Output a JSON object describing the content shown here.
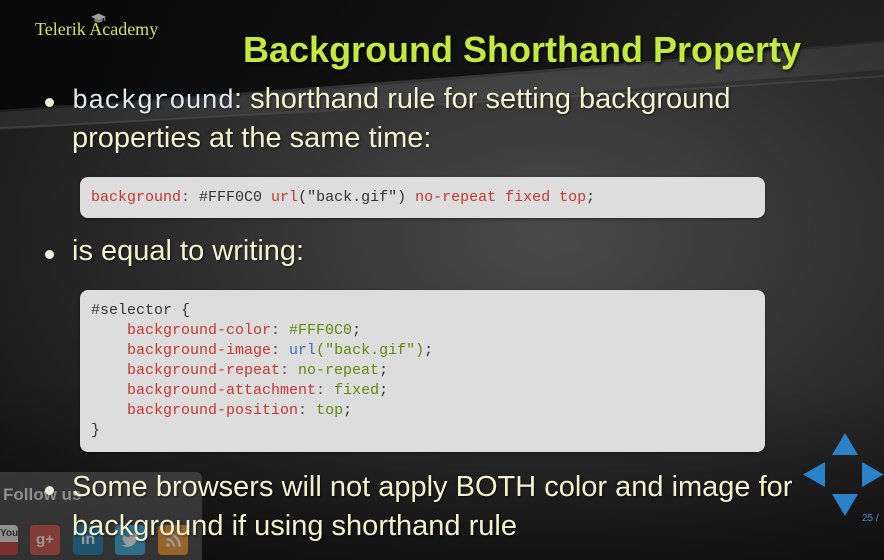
{
  "app": {
    "brand": "Telerik Academy",
    "brand_icon": "graduation-cap-icon"
  },
  "slide": {
    "title": "Background Shorthand Property",
    "bullet_1": {
      "code_term": "background",
      "line_1": ": shorthand rule for setting background",
      "line_2": "properties at the same time:"
    },
    "bullet_2": {
      "line_1": "is equal to writing:"
    },
    "bullet_3": {
      "line_1": "Some browsers will not apply BOTH color and image for",
      "line_2": "background if using shorthand rule"
    },
    "code_blocks": [
      {
        "lines": [
          [
            {
              "t": "background",
              "color": "#c7372f"
            },
            {
              "t": ": ",
              "color": "#555555"
            },
            {
              "t": "#FFF0C0",
              "color": "#333333"
            },
            {
              "t": " url",
              "color": "#c7372f"
            },
            {
              "t": "(\"back.gif\")",
              "color": "#333333"
            },
            {
              "t": " no-repeat fixed top",
              "color": "#c7372f"
            },
            {
              "t": ";",
              "color": "#333333"
            }
          ]
        ]
      },
      {
        "lines": [
          [
            {
              "t": "#selector {",
              "color": "#333333"
            }
          ],
          [
            {
              "t": "    background-color",
              "color": "#c7372f"
            },
            {
              "t": ": ",
              "color": "#555555"
            },
            {
              "t": "#FFF0C0",
              "color": "#5e8a10"
            },
            {
              "t": ";",
              "color": "#333333"
            }
          ],
          [
            {
              "t": "    background-image",
              "color": "#c7372f"
            },
            {
              "t": ": ",
              "color": "#555555"
            },
            {
              "t": "url",
              "color": "#3a6fb6"
            },
            {
              "t": "(\"back.gif\")",
              "color": "#5e8a10"
            },
            {
              "t": ";",
              "color": "#333333"
            }
          ],
          [
            {
              "t": "    background-repeat",
              "color": "#c7372f"
            },
            {
              "t": ": ",
              "color": "#555555"
            },
            {
              "t": "no-repeat",
              "color": "#5e8a10"
            },
            {
              "t": ";",
              "color": "#333333"
            }
          ],
          [
            {
              "t": "    background-attachment",
              "color": "#c7372f"
            },
            {
              "t": ": ",
              "color": "#555555"
            },
            {
              "t": "fixed",
              "color": "#5e8a10"
            },
            {
              "t": ";",
              "color": "#333333"
            }
          ],
          [
            {
              "t": "    background-position",
              "color": "#c7372f"
            },
            {
              "t": ": ",
              "color": "#555555"
            },
            {
              "t": "top",
              "color": "#5e8a10"
            },
            {
              "t": ";",
              "color": "#333333"
            }
          ],
          [
            {
              "t": "}",
              "color": "#333333"
            }
          ]
        ]
      }
    ]
  },
  "follow_widget": {
    "label": "Follow us",
    "icons": [
      {
        "name": "youtube-icon",
        "glyph": "You",
        "color": "#c4302b"
      },
      {
        "name": "google-plus-icon",
        "glyph": "g+",
        "color": "#d34836"
      },
      {
        "name": "linkedin-icon",
        "glyph": "in",
        "color": "#0e76a8"
      },
      {
        "name": "twitter-icon",
        "color": "#2aa9e0"
      },
      {
        "name": "rss-icon",
        "color": "#f7931e"
      }
    ]
  },
  "navigation": {
    "arrows": [
      "nav-up-arrow-icon",
      "nav-left-arrow-icon",
      "nav-right-arrow-icon",
      "nav-down-arrow-icon"
    ],
    "page_indicator": "25 /"
  },
  "colors": {
    "title": "#c3ea3c",
    "brand": "#cde65a",
    "bullet_text": "#f1f4cf",
    "inline_code": "#dfe9f2",
    "code_background": "#dddddd",
    "nav_arrow": "#2b82c9",
    "page_indicator": "#4d8fd0",
    "follow_label": "#8e8e8e"
  }
}
